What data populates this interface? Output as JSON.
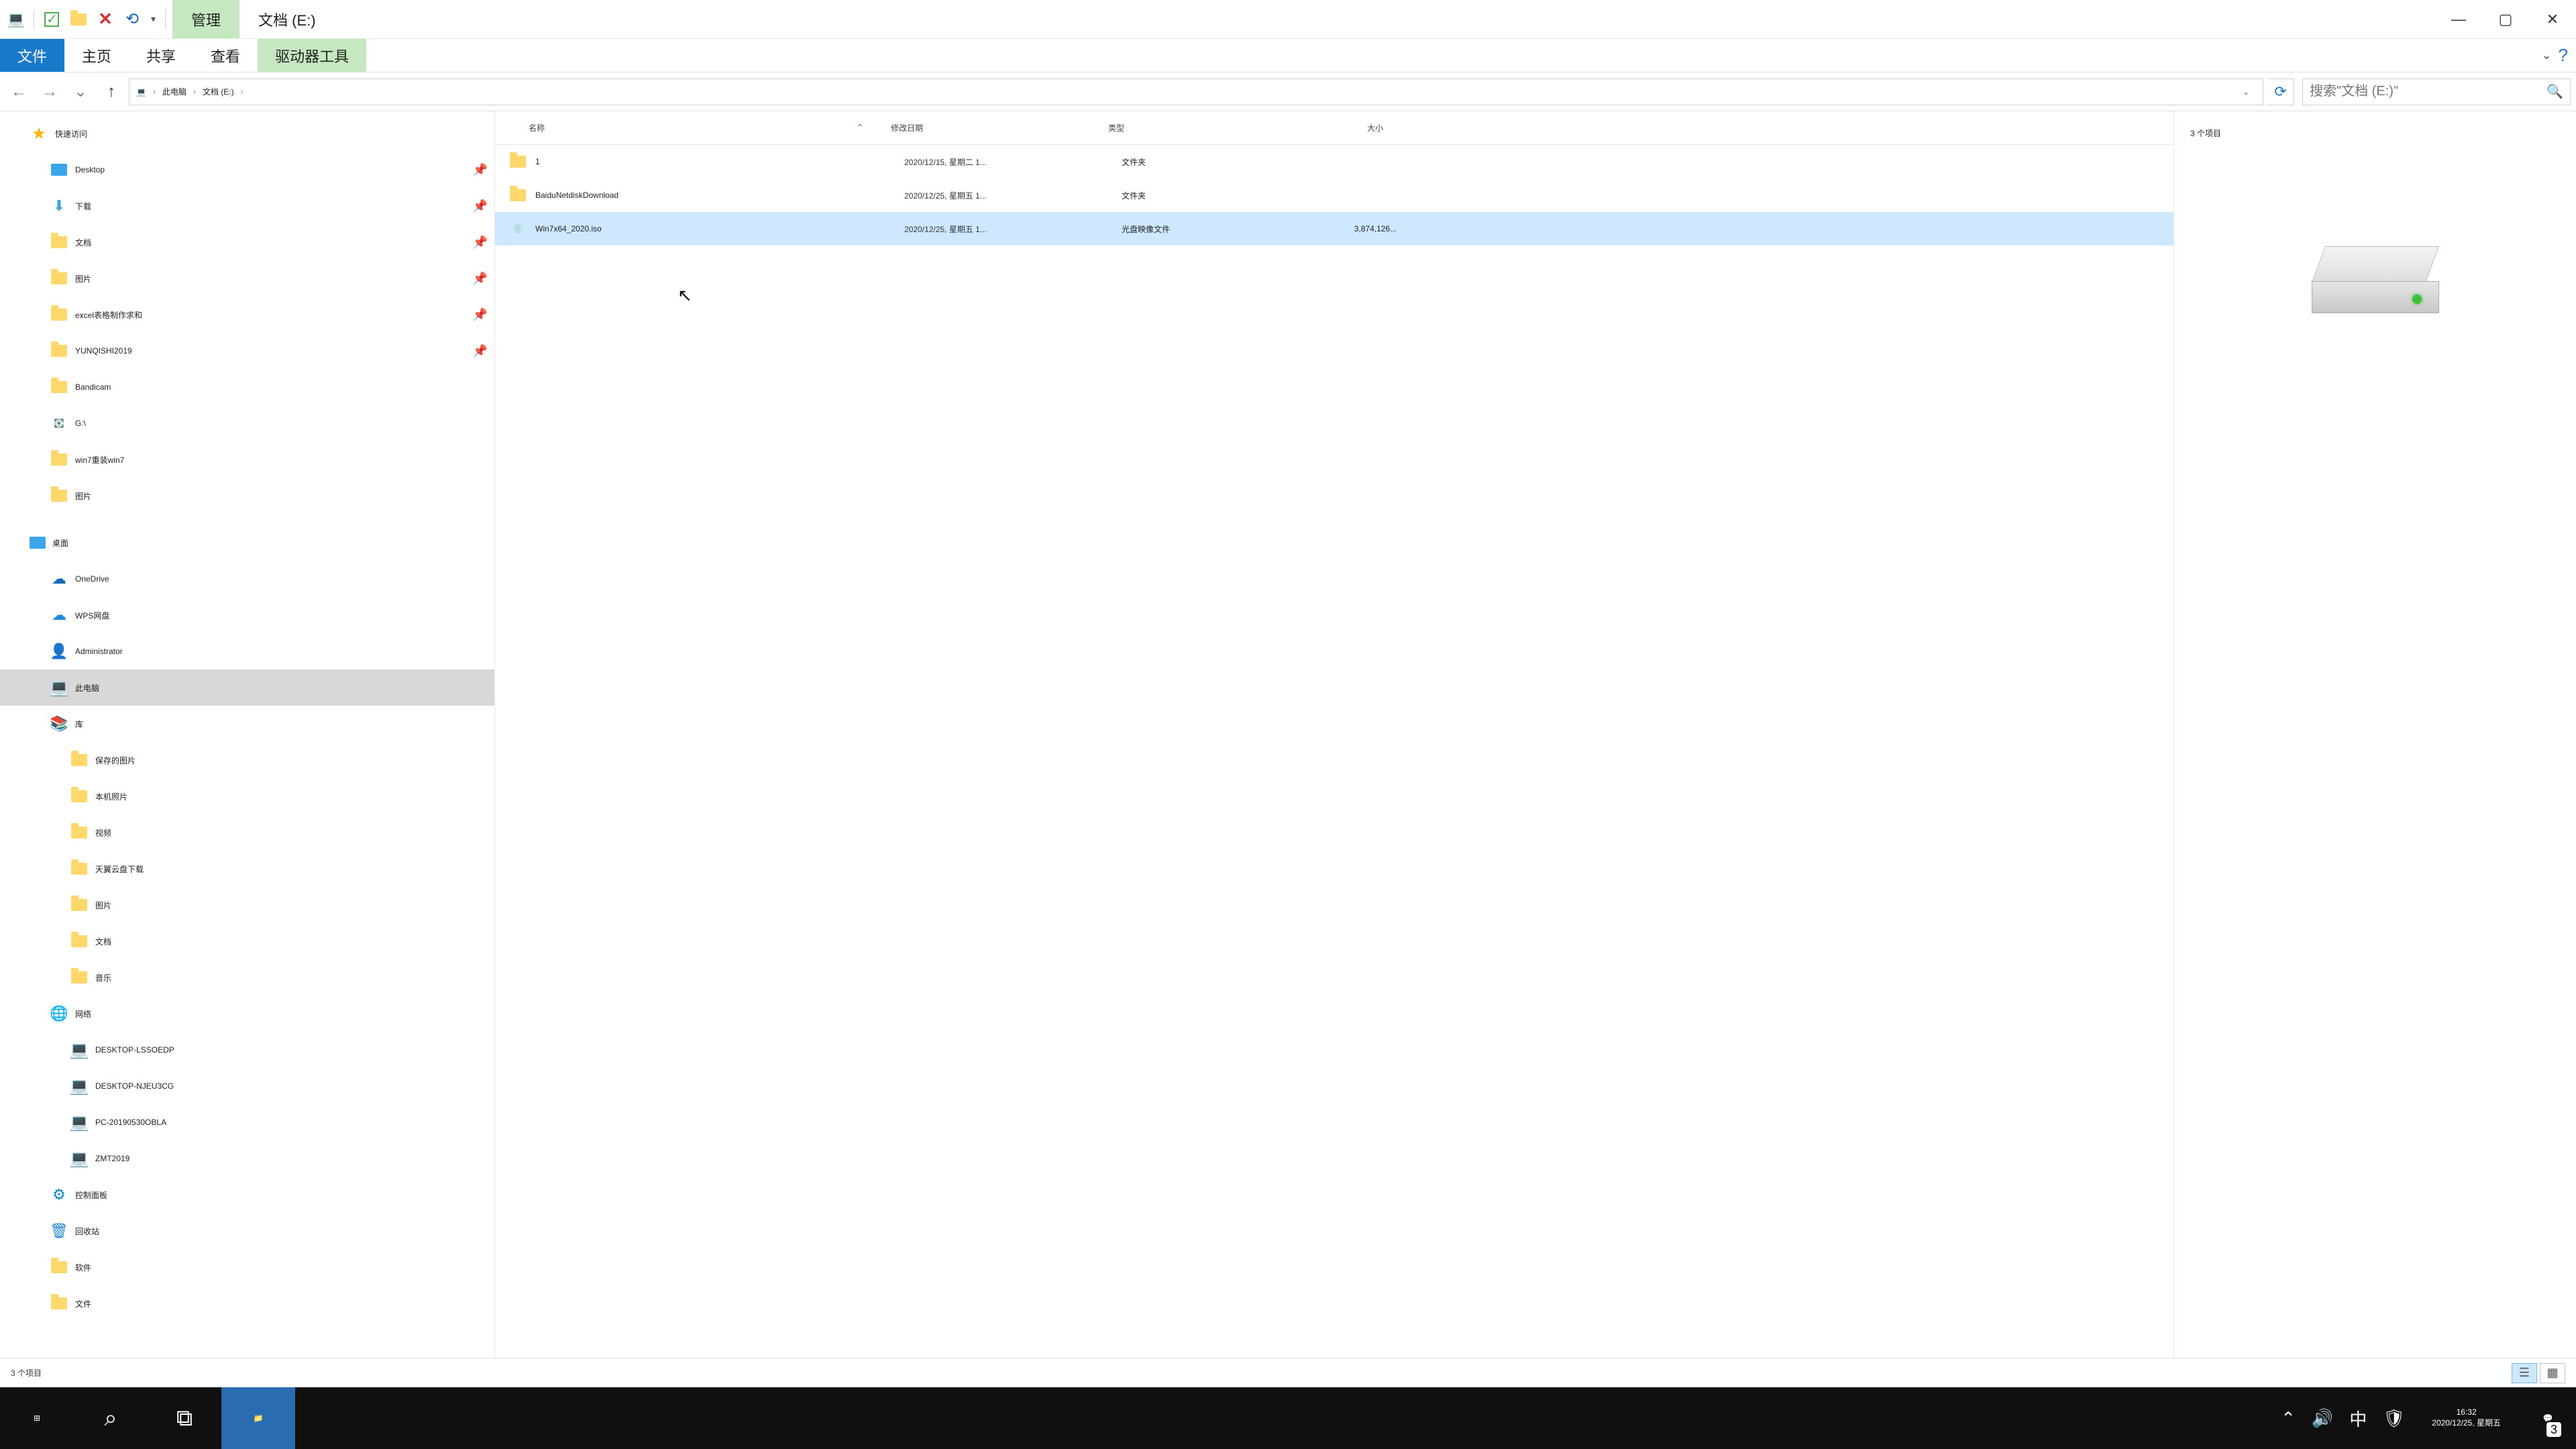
{
  "title": {
    "context_tab": "管理",
    "window_title": "文档 (E:)"
  },
  "ribbon": {
    "file": "文件",
    "tabs": [
      "主页",
      "共享",
      "查看"
    ],
    "context": "驱动器工具"
  },
  "nav": {
    "back": "←",
    "forward": "→",
    "up": "↑"
  },
  "breadcrumb": {
    "root_icon": "💻",
    "segments": [
      "此电脑",
      "文档 (E:)"
    ]
  },
  "search": {
    "placeholder": "搜索\"文档 (E:)\""
  },
  "navpane": {
    "quick": {
      "label": "快速访问",
      "items": [
        {
          "label": "Desktop",
          "icon": "desktop",
          "pin": true
        },
        {
          "label": "下载",
          "icon": "download",
          "pin": true
        },
        {
          "label": "文档",
          "icon": "folder",
          "pin": true
        },
        {
          "label": "图片",
          "icon": "folder",
          "pin": true
        },
        {
          "label": "excel表格制作求和",
          "icon": "folder",
          "pin": true
        },
        {
          "label": "YUNQISHI2019",
          "icon": "folder",
          "pin": true
        },
        {
          "label": "Bandicam",
          "icon": "folder",
          "pin": false
        },
        {
          "label": "G:\\",
          "icon": "drive",
          "pin": false
        },
        {
          "label": "win7重装win7",
          "icon": "folder",
          "pin": false
        },
        {
          "label": "图片",
          "icon": "folder",
          "pin": false
        }
      ]
    },
    "desktop_root": {
      "label": "桌面",
      "items": [
        {
          "label": "OneDrive",
          "icon": "cloud"
        },
        {
          "label": "WPS网盘",
          "icon": "wps"
        },
        {
          "label": "Administrator",
          "icon": "user"
        },
        {
          "label": "此电脑",
          "icon": "pc",
          "selected": true
        },
        {
          "label": "库",
          "icon": "lib",
          "children": [
            {
              "label": "保存的图片",
              "icon": "folder"
            },
            {
              "label": "本机照片",
              "icon": "folder"
            },
            {
              "label": "视频",
              "icon": "folder"
            },
            {
              "label": "天翼云盘下载",
              "icon": "folder"
            },
            {
              "label": "图片",
              "icon": "folder"
            },
            {
              "label": "文档",
              "icon": "folder"
            },
            {
              "label": "音乐",
              "icon": "folder"
            }
          ]
        },
        {
          "label": "网络",
          "icon": "net",
          "children": [
            {
              "label": "DESKTOP-LSSOEDP",
              "icon": "pc"
            },
            {
              "label": "DESKTOP-NJEU3CG",
              "icon": "pc"
            },
            {
              "label": "PC-20190530OBLA",
              "icon": "pc"
            },
            {
              "label": "ZMT2019",
              "icon": "pc"
            }
          ]
        },
        {
          "label": "控制面板",
          "icon": "panel"
        },
        {
          "label": "回收站",
          "icon": "recycle"
        },
        {
          "label": "软件",
          "icon": "folder"
        },
        {
          "label": "文件",
          "icon": "folder"
        }
      ]
    }
  },
  "columns": {
    "name": "名称",
    "date": "修改日期",
    "type": "类型",
    "size": "大小"
  },
  "files": [
    {
      "name": "1",
      "date": "2020/12/15, 星期二 1...",
      "type": "文件夹",
      "size": "",
      "icon": "folder"
    },
    {
      "name": "BaiduNetdiskDownload",
      "date": "2020/12/25, 星期五 1...",
      "type": "文件夹",
      "size": "",
      "icon": "folder"
    },
    {
      "name": "Win7x64_2020.iso",
      "date": "2020/12/25, 星期五 1...",
      "type": "光盘映像文件",
      "size": "3,874,126...",
      "icon": "disc",
      "selected": true
    }
  ],
  "preview": {
    "count_label": "3 个项目"
  },
  "status": {
    "left": "3 个项目"
  },
  "taskbar": {
    "time": "16:32",
    "date": "2020/12/25, 星期五",
    "ime": "中",
    "notif_count": "3"
  }
}
